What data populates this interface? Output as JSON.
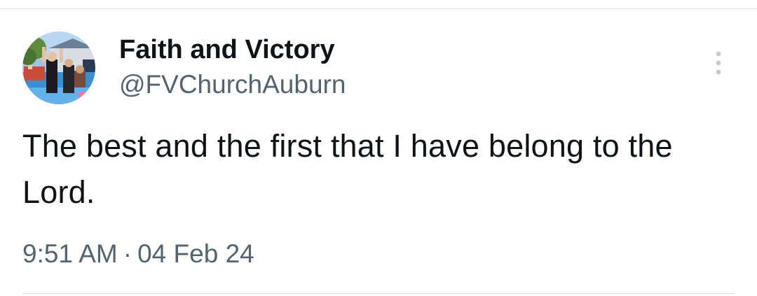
{
  "tweet": {
    "author": {
      "display_name": "Faith and Victory",
      "handle": "@FVChurchAuburn"
    },
    "text": "The best and the first that I have belong to the Lord.",
    "time": "9:51 AM",
    "separator": "·",
    "date": "04 Feb 24"
  },
  "icons": {
    "more": "more-vertical-icon",
    "avatar": "profile-photo"
  },
  "colors": {
    "text_primary": "#0f1419",
    "text_secondary": "#536471",
    "divider": "#e1e5e8",
    "icon": "#c4cbd0"
  }
}
